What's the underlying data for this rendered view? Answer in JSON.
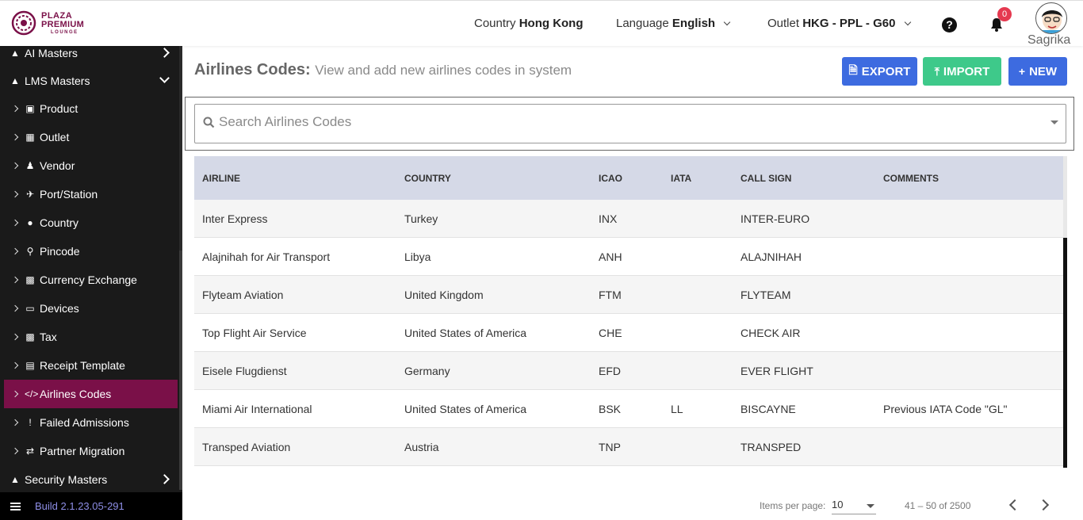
{
  "brand": {
    "line1": "PLAZA",
    "line2": "PREMIUM",
    "line3": "LOUNGE",
    "color": "#7a1048"
  },
  "topbar": {
    "country_label": "Country",
    "country_value": "Hong Kong",
    "language_label": "Language",
    "language_value": "English",
    "outlet_label": "Outlet",
    "outlet_value": "HKG - PPL - G60",
    "notification_count": "0",
    "username": "Sagrika"
  },
  "sidebar": {
    "top_items": [
      {
        "label": "AI Masters"
      },
      {
        "label": "LMS Masters"
      }
    ],
    "sub_items": [
      {
        "label": "Product",
        "icon": "gift-icon"
      },
      {
        "label": "Outlet",
        "icon": "building-icon"
      },
      {
        "label": "Vendor",
        "icon": "person-icon"
      },
      {
        "label": "Port/Station",
        "icon": "plane-icon"
      },
      {
        "label": "Country",
        "icon": "globe-icon"
      },
      {
        "label": "Pincode",
        "icon": "map-marker-icon"
      },
      {
        "label": "Currency Exchange",
        "icon": "money-icon"
      },
      {
        "label": "Devices",
        "icon": "laptop-icon"
      },
      {
        "label": "Tax",
        "icon": "money-icon"
      },
      {
        "label": "Receipt Template",
        "icon": "list-icon"
      },
      {
        "label": "Airlines Codes",
        "icon": "code-icon"
      },
      {
        "label": "Failed Admissions",
        "icon": "exclamation-icon"
      },
      {
        "label": "Partner Migration",
        "icon": "exchange-icon"
      }
    ],
    "bottom_item": {
      "label": "Security Masters"
    },
    "build": "Build 2.1.23.05-291",
    "active_color": "#7a1048"
  },
  "page": {
    "title": "Airlines Codes:",
    "subtitle": "View and add new airlines codes in system",
    "export_label": "EXPORT",
    "import_label": "IMPORT",
    "new_label": "NEW",
    "search_placeholder": "Search Airlines Codes"
  },
  "table": {
    "headers": [
      "AIRLINE",
      "COUNTRY",
      "ICAO",
      "IATA",
      "CALL SIGN",
      "COMMENTS"
    ],
    "rows": [
      [
        "Inter Express",
        "Turkey",
        "INX",
        "",
        "INTER-EURO",
        ""
      ],
      [
        "Alajnihah for Air Transport",
        "Libya",
        "ANH",
        "",
        "ALAJNIHAH",
        ""
      ],
      [
        "Flyteam Aviation",
        "United Kingdom",
        "FTM",
        "",
        "FLYTEAM",
        ""
      ],
      [
        "Top Flight Air Service",
        "United States of America",
        "CHE",
        "",
        "CHECK AIR",
        ""
      ],
      [
        "Eisele Flugdienst",
        "Germany",
        "EFD",
        "",
        "EVER FLIGHT",
        ""
      ],
      [
        "Miami Air International",
        "United States of America",
        "BSK",
        "LL",
        "BISCAYNE",
        "Previous IATA Code \"GL\""
      ],
      [
        "Transped Aviation",
        "Austria",
        "TNP",
        "",
        "TRANSPED",
        ""
      ]
    ]
  },
  "pager": {
    "items_per_page_label": "Items per page:",
    "items_per_page": "10",
    "range": "41 – 50 of 2500"
  }
}
